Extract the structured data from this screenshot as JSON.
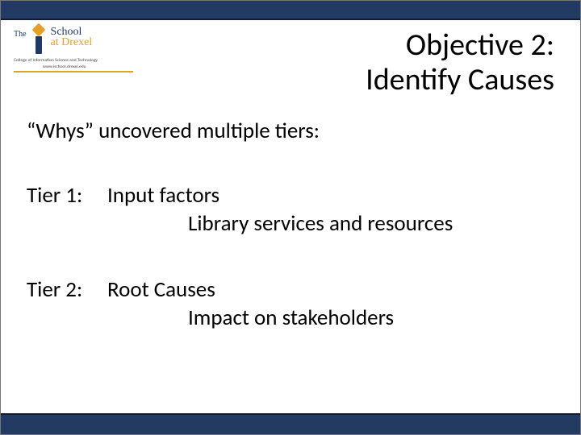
{
  "logo": {
    "the": "The",
    "school": "School",
    "at_drexel": "at Drexel",
    "subline": "College of Information Science and Technology",
    "url": "www.ischool.drexel.edu"
  },
  "title": {
    "line1": "Objective 2:",
    "line2": "Identify Causes"
  },
  "body": {
    "intro": "“Whys” uncovered multiple tiers:",
    "tier1": {
      "label": "Tier 1:",
      "first": "Input factors",
      "second": "Library services and resources"
    },
    "tier2": {
      "label": "Tier 2:",
      "first": "Root Causes",
      "second": "Impact on stakeholders"
    }
  }
}
